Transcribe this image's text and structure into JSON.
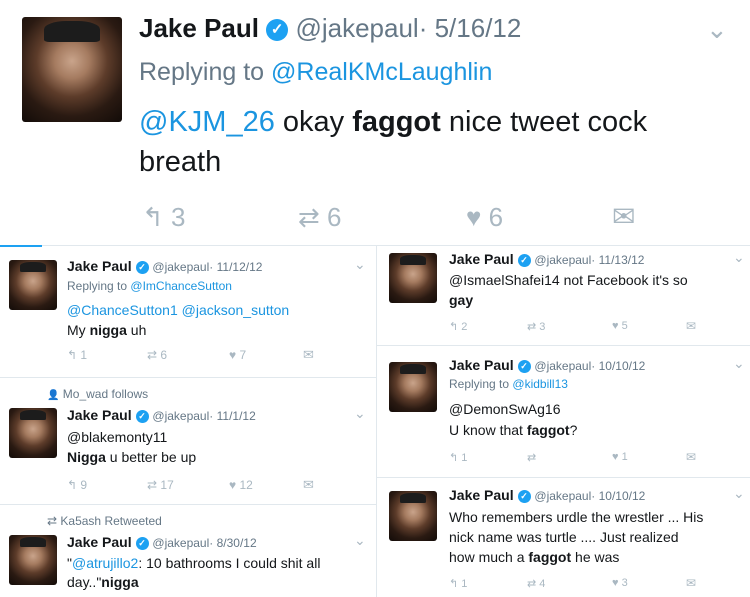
{
  "main_tweet": {
    "name": "Jake Paul",
    "handle": "@jakepaul",
    "date": "· 5/16/12",
    "reply_prefix": "Replying to",
    "reply_to": "@RealKMcLaughlin",
    "mention": "@KJM_26",
    "text_pre": "okay",
    "text_bold": "faggot",
    "text_post": "nice tweet cock",
    "text_line2": "breath",
    "replies": "3",
    "retweets": "6",
    "likes": "6"
  },
  "t1": {
    "name": "Jake Paul",
    "handle": "@jakepaul",
    "date": "· 11/12/12",
    "reply_prefix": "Replying to",
    "reply_to": "@ImChanceSutton",
    "mentions": "@ChanceSutton1 @jackson_sutton",
    "text_pre": "My",
    "text_bold": "nigga",
    "text_post": "uh",
    "replies": "1",
    "retweets": "6",
    "likes": "7"
  },
  "t2": {
    "context": "Mo_wad follows",
    "name": "Jake Paul",
    "handle": "@jakepaul",
    "date": "· 11/1/12",
    "line1": "@blakemonty11",
    "text_bold": "Nigga",
    "text_post": "u better be up",
    "replies": "9",
    "retweets": "17",
    "likes": "12"
  },
  "t3": {
    "context": "Ka5ash Retweeted",
    "name": "Jake Paul",
    "handle": "@jakepaul",
    "date": "· 8/30/12",
    "quote_open": "\"",
    "mention": "@atrujillo2",
    "text_post": ": 10 bathrooms I could shit all",
    "line2_pre": "day..\"",
    "line2_bold": "nigga"
  },
  "t4": {
    "name": "Jake Paul",
    "handle": "@jakepaul",
    "date": "· 11/13/12",
    "line1": "@IsmaelShafei14 not Facebook it's so",
    "line2_bold": "gay",
    "replies": "2",
    "retweets": "3",
    "likes": "5"
  },
  "t5": {
    "name": "Jake Paul",
    "handle": "@jakepaul",
    "date": "· 10/10/12",
    "reply_prefix": "Replying to",
    "reply_to": "@kidbill13",
    "line1": "@DemonSwAg16",
    "line2_pre": "U know that",
    "line2_bold": "faggot",
    "line2_post": "?",
    "replies": "1",
    "likes": "1"
  },
  "t6": {
    "name": "Jake Paul",
    "handle": "@jakepaul",
    "date": "· 10/10/12",
    "line1": "Who remembers urdle the wrestler ... His",
    "line2": "nick name was turtle .... Just realized",
    "line3_pre": "how much a",
    "line3_bold": "faggot",
    "line3_post": "he was",
    "replies": "1",
    "retweets": "4",
    "likes": "3"
  },
  "icons": {
    "verified": "✓",
    "chevron": "⌄",
    "reply": "↰",
    "retweet": "⇄",
    "like": "♥",
    "dm": "✉",
    "follow": "👤"
  }
}
